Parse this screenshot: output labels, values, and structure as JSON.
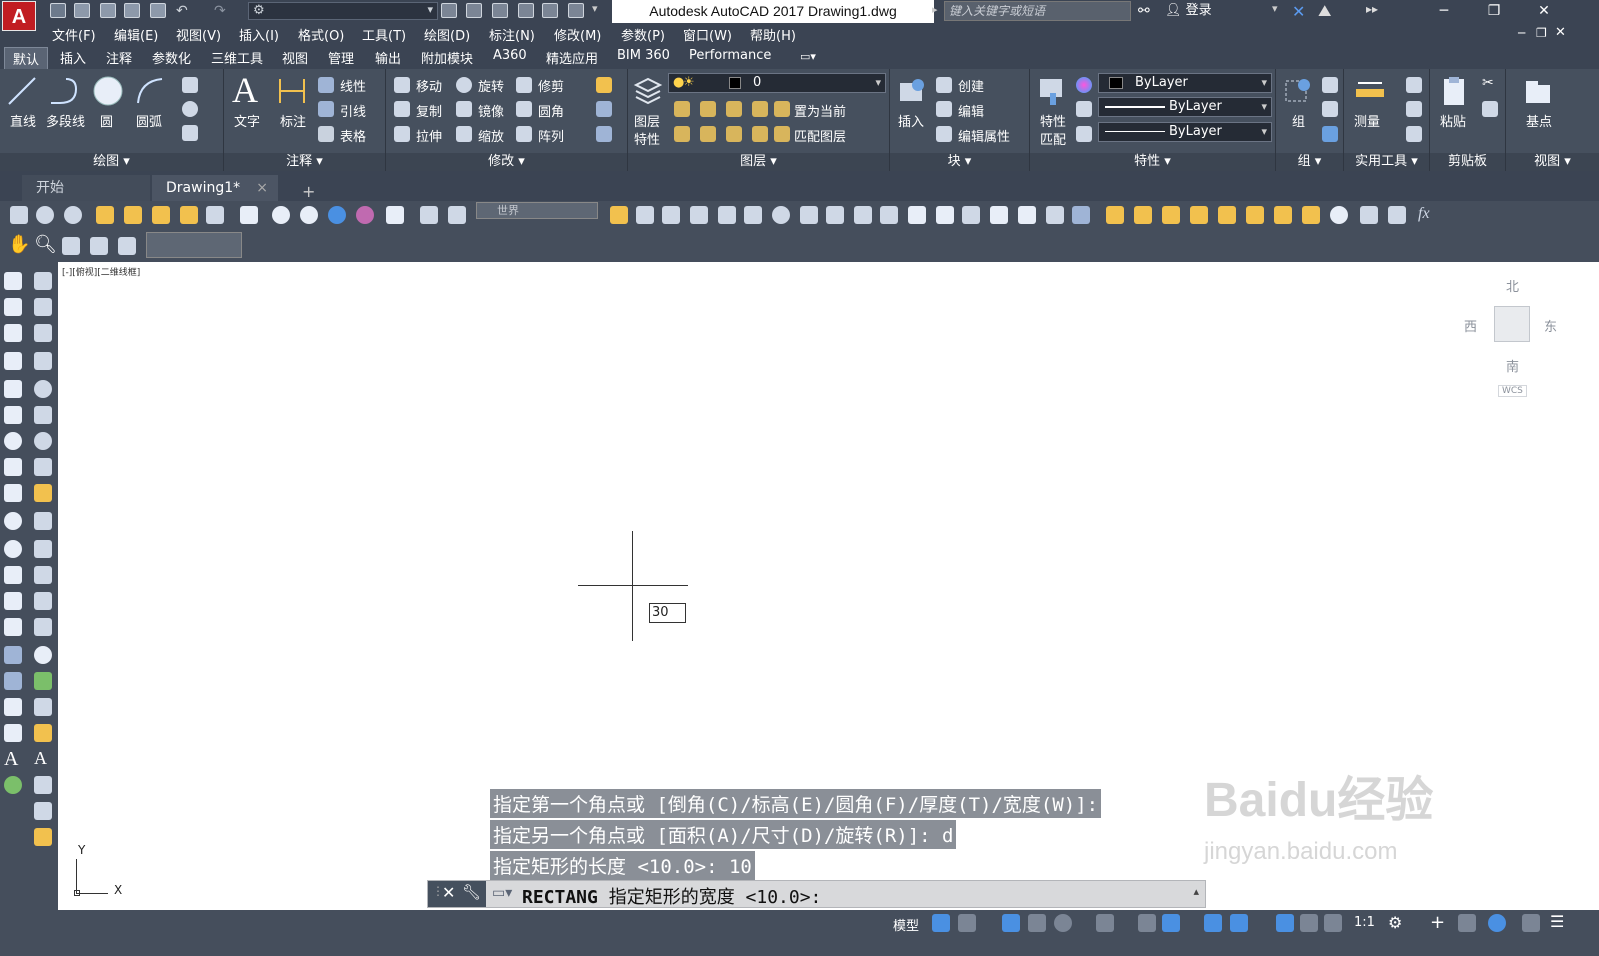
{
  "titlebar": {
    "logo": "A",
    "app_title": "Autodesk AutoCAD 2017    Drawing1.dwg",
    "search_placeholder": "键入关键字或短语",
    "login_label": "登录",
    "workspace_value": ""
  },
  "menubar": [
    "文件(F)",
    "编辑(E)",
    "视图(V)",
    "插入(I)",
    "格式(O)",
    "工具(T)",
    "绘图(D)",
    "标注(N)",
    "修改(M)",
    "参数(P)",
    "窗口(W)",
    "帮助(H)"
  ],
  "ribbon_tabs": [
    "默认",
    "插入",
    "注释",
    "参数化",
    "三维工具",
    "视图",
    "管理",
    "输出",
    "附加模块",
    "A360",
    "精选应用",
    "BIM 360",
    "Performance"
  ],
  "ribbon": {
    "draw": {
      "title": "绘图",
      "line": "直线",
      "polyline": "多段线",
      "circle": "圆",
      "arc": "圆弧"
    },
    "annotation": {
      "title": "注释",
      "text": "文字",
      "dimension": "标注",
      "linear": "线性",
      "leader": "引线",
      "table": "表格"
    },
    "modify": {
      "title": "修改",
      "move": "移动",
      "rotate": "旋转",
      "trim": "修剪",
      "copy": "复制",
      "mirror": "镜像",
      "fillet": "圆角",
      "stretch": "拉伸",
      "scale": "缩放",
      "array": "阵列"
    },
    "layers": {
      "title": "图层",
      "layer_props_1": "图层",
      "layer_props_2": "特性",
      "current_layer": "0",
      "make_current": "置为当前",
      "match_layer": "匹配图层"
    },
    "block": {
      "title": "块",
      "insert": "插入",
      "create": "创建",
      "edit": "编辑",
      "edit_attributes": "编辑属性"
    },
    "properties": {
      "title": "特性",
      "match_1": "特性",
      "match_2": "匹配",
      "color": "ByLayer",
      "linetype": "ByLayer",
      "lineweight": "ByLayer"
    },
    "groups": {
      "title": "组",
      "group": "组"
    },
    "utilities": {
      "title": "实用工具",
      "measure": "测量"
    },
    "clipboard": {
      "title": "剪贴板",
      "paste": "粘贴"
    },
    "view": {
      "title": "视图",
      "base": "基点"
    }
  },
  "file_tabs": {
    "start": "开始",
    "drawing": "Drawing1*",
    "close": "×",
    "add": "+"
  },
  "toolbar": {
    "ucs_combo": "世界"
  },
  "canvas": {
    "viewport_label": "[-][俯视][二维线框]",
    "viewcube": {
      "north": "北",
      "south": "南",
      "east": "东",
      "west": "西",
      "wcs": "WCS"
    },
    "dynamic_input_value": "30",
    "ucs_x": "X",
    "ucs_y": "Y"
  },
  "command_history": [
    "指定第一个角点或 [倒角(C)/标高(E)/圆角(F)/厚度(T)/宽度(W)]:",
    "指定另一个角点或 [面积(A)/尺寸(D)/旋转(R)]: d",
    "指定矩形的长度 <10.0>: 10"
  ],
  "command_line": {
    "command": "RECTANG",
    "prompt": "指定矩形的宽度 <10.0>:"
  },
  "statusbar": {
    "model": "模型",
    "scale": "1:1"
  },
  "watermark": {
    "text": "Baidu经验",
    "url": "jingyan.baidu.com"
  }
}
